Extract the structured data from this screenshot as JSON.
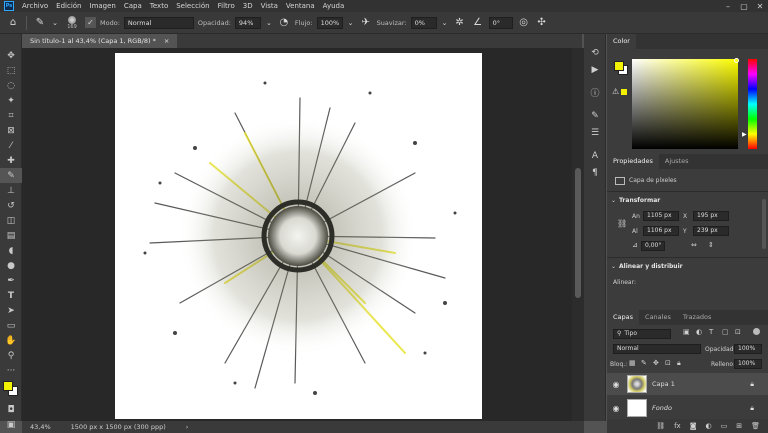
{
  "menu": {
    "items": [
      "Archivo",
      "Edición",
      "Imagen",
      "Capa",
      "Texto",
      "Selección",
      "Filtro",
      "3D",
      "Vista",
      "Ventana",
      "Ayuda"
    ],
    "app_logo": "Ps"
  },
  "options": {
    "brush_size": "169",
    "mode_label": "Modo:",
    "mode_value": "Normal",
    "opacity_label": "Opacidad:",
    "opacity_value": "94%",
    "flow_label": "Flujo:",
    "flow_value": "100%",
    "smooth_label": "Suavizar:",
    "smooth_value": "0%",
    "angle_value": "0°"
  },
  "document": {
    "tab_title": "Sin título-1 al 43,4% (Capa 1, RGB/8) *",
    "close_glyph": "×"
  },
  "status": {
    "zoom": "43,4%",
    "doc_info": "1500 px x 1500 px (300 ppp)"
  },
  "color_panel": {
    "tab": "Color",
    "foreground": "#f2f200",
    "background": "#ffffff"
  },
  "properties": {
    "tabs": [
      "Propiedades",
      "Ajustes"
    ],
    "kind": "Capa de píxeles",
    "transform_title": "Transformar",
    "w_label": "An",
    "w_value": "1105 px",
    "x_label": "X",
    "x_value": "195 px",
    "h_label": "Al",
    "h_value": "1106 px",
    "y_label": "Y",
    "y_value": "239 px",
    "angle_value": "0,00°",
    "align_title": "Alinear y distribuir",
    "align_label": "Alinear:"
  },
  "layers": {
    "tabs": [
      "Capas",
      "Canales",
      "Trazados"
    ],
    "filter_value": "Tipo",
    "blend_mode": "Normal",
    "opacity_label": "Opacidad:",
    "opacity_value": "100%",
    "lock_label": "Bloq.:",
    "fill_label": "Relleno:",
    "fill_value": "100%",
    "items": [
      {
        "name": "Capa 1"
      },
      {
        "name": "Fondo"
      }
    ]
  }
}
